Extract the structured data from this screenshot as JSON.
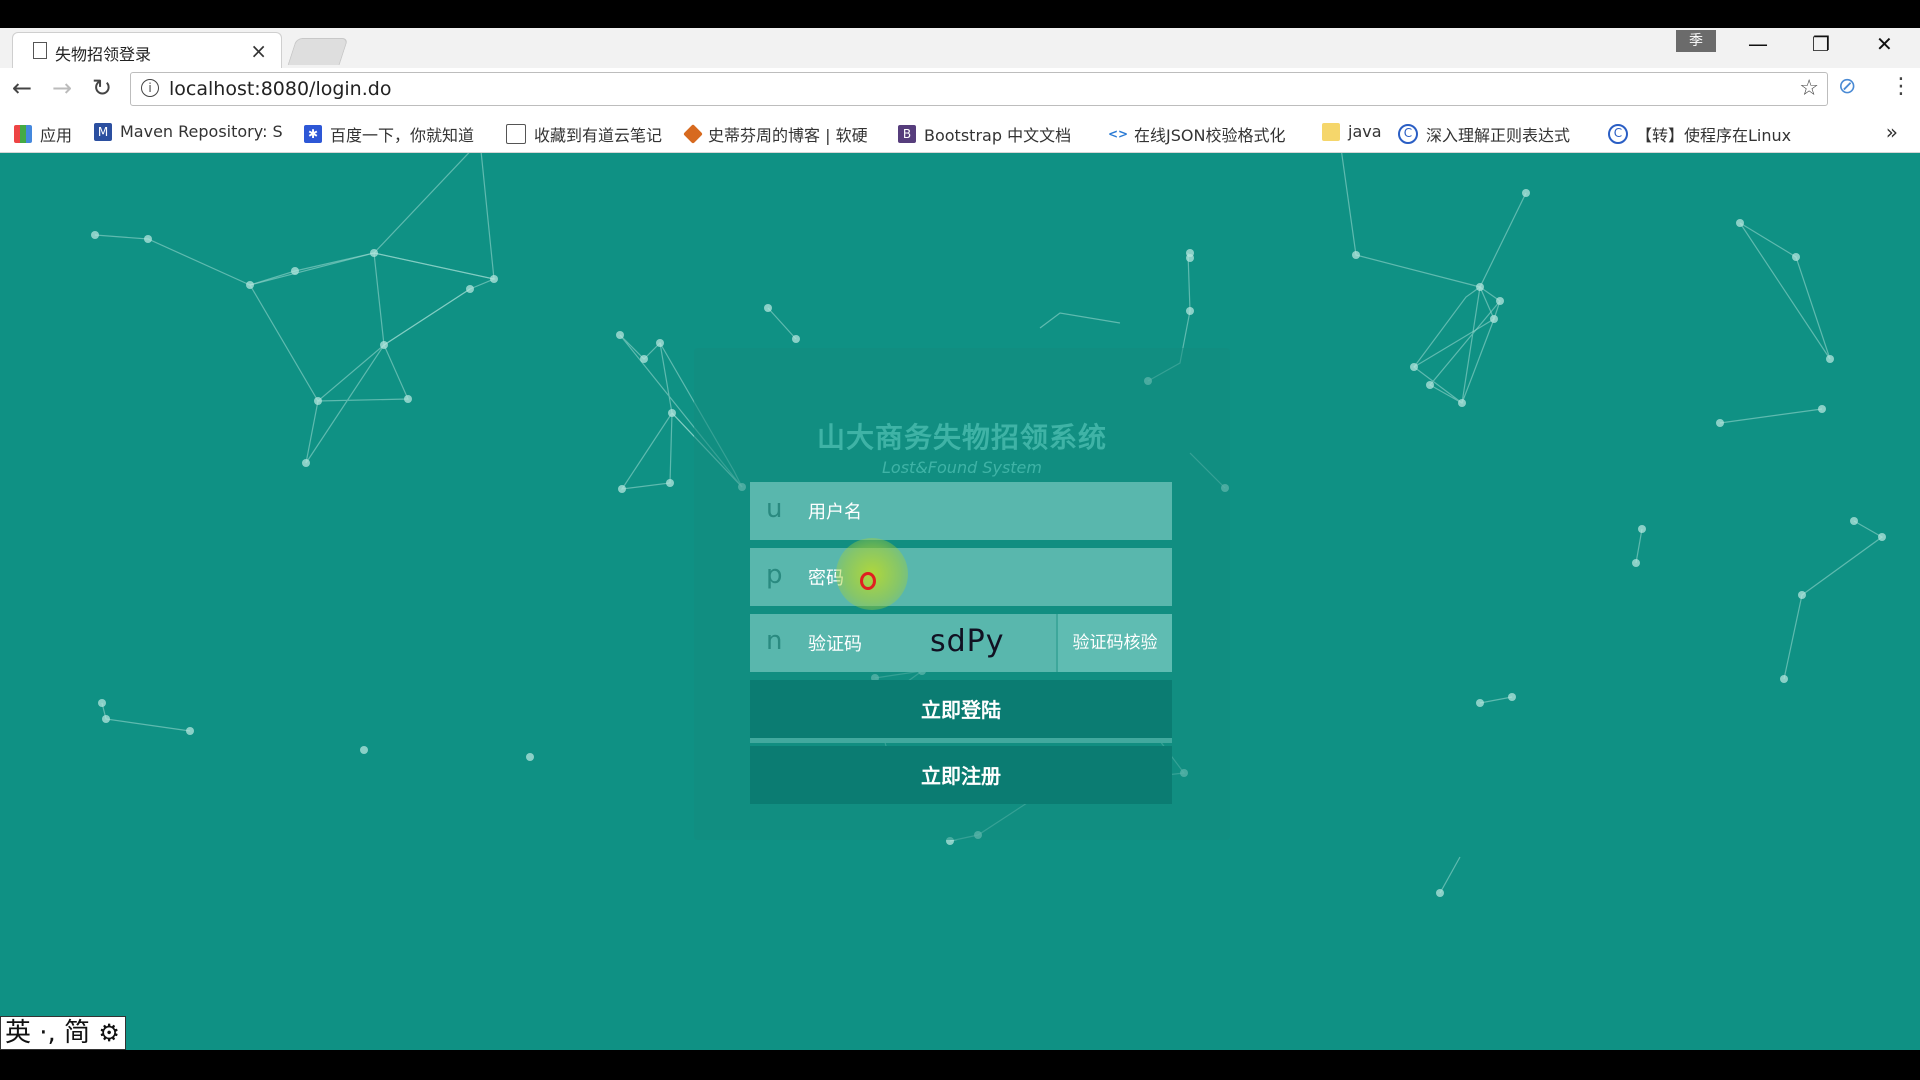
{
  "tab": {
    "title": "失物招领登录",
    "close": "×"
  },
  "window": {
    "minimize": "—",
    "restore": "❐",
    "close": "✕",
    "ime_badge": "季"
  },
  "address": {
    "url": "localhost:8080/login.do",
    "info": "i"
  },
  "bookmarks": [
    {
      "label": "应用",
      "icon": "apps-icon"
    },
    {
      "label": "Maven Repository: S",
      "icon": "maven-icon"
    },
    {
      "label": "百度一下，你就知道",
      "icon": "baidu-icon"
    },
    {
      "label": "收藏到有道云笔记",
      "icon": "page-icon"
    },
    {
      "label": "史蒂芬周的博客 | 软硬",
      "icon": "blog-icon"
    },
    {
      "label": "Bootstrap 中文文档",
      "icon": "bootstrap-icon"
    },
    {
      "label": "在线JSON校验格式化",
      "icon": "json-icon"
    },
    {
      "label": "java",
      "icon": "folder-icon"
    },
    {
      "label": "深入理解正则表达式",
      "icon": "regex-icon"
    },
    {
      "label": "【转】使程序在Linux",
      "icon": "link-icon"
    }
  ],
  "login": {
    "title": "山大商务失物招领系统",
    "subtitle": "Lost&Found System",
    "username": {
      "prefix": "u",
      "placeholder": "用户名"
    },
    "password": {
      "prefix": "p",
      "placeholder": "密码"
    },
    "captcha": {
      "prefix": "n",
      "placeholder": "验证码",
      "code": "sdPy",
      "verify_label": "验证码核验"
    },
    "login_button": "立即登陆",
    "register_button": "立即注册"
  },
  "ime": {
    "text": "英 ·, 简"
  },
  "colors": {
    "page_bg": "#0f9184",
    "button": "#0b7c72",
    "field": "#59b7ad"
  }
}
